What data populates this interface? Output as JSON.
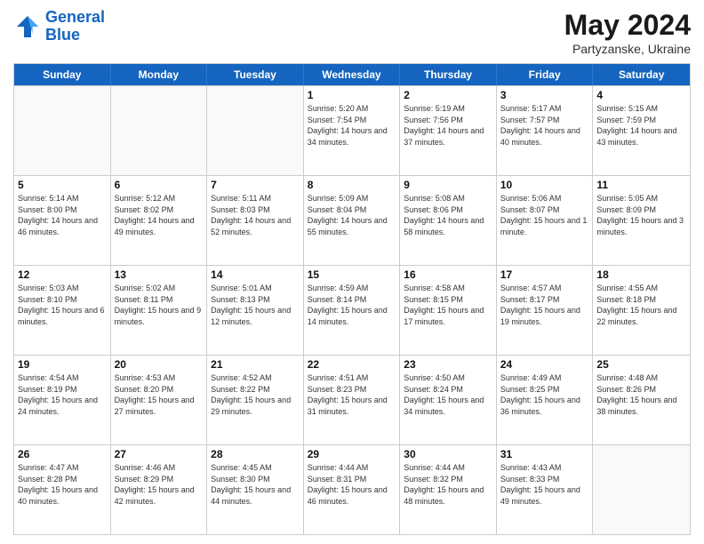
{
  "header": {
    "logo_line1": "General",
    "logo_line2": "Blue",
    "month_title": "May 2024",
    "location": "Partyzanske, Ukraine"
  },
  "days_of_week": [
    "Sunday",
    "Monday",
    "Tuesday",
    "Wednesday",
    "Thursday",
    "Friday",
    "Saturday"
  ],
  "weeks": [
    [
      {
        "day": "",
        "sunrise": "",
        "sunset": "",
        "daylight": "",
        "empty": true
      },
      {
        "day": "",
        "sunrise": "",
        "sunset": "",
        "daylight": "",
        "empty": true
      },
      {
        "day": "",
        "sunrise": "",
        "sunset": "",
        "daylight": "",
        "empty": true
      },
      {
        "day": "1",
        "sunrise": "Sunrise: 5:20 AM",
        "sunset": "Sunset: 7:54 PM",
        "daylight": "Daylight: 14 hours and 34 minutes.",
        "empty": false
      },
      {
        "day": "2",
        "sunrise": "Sunrise: 5:19 AM",
        "sunset": "Sunset: 7:56 PM",
        "daylight": "Daylight: 14 hours and 37 minutes.",
        "empty": false
      },
      {
        "day": "3",
        "sunrise": "Sunrise: 5:17 AM",
        "sunset": "Sunset: 7:57 PM",
        "daylight": "Daylight: 14 hours and 40 minutes.",
        "empty": false
      },
      {
        "day": "4",
        "sunrise": "Sunrise: 5:15 AM",
        "sunset": "Sunset: 7:59 PM",
        "daylight": "Daylight: 14 hours and 43 minutes.",
        "empty": false
      }
    ],
    [
      {
        "day": "5",
        "sunrise": "Sunrise: 5:14 AM",
        "sunset": "Sunset: 8:00 PM",
        "daylight": "Daylight: 14 hours and 46 minutes.",
        "empty": false
      },
      {
        "day": "6",
        "sunrise": "Sunrise: 5:12 AM",
        "sunset": "Sunset: 8:02 PM",
        "daylight": "Daylight: 14 hours and 49 minutes.",
        "empty": false
      },
      {
        "day": "7",
        "sunrise": "Sunrise: 5:11 AM",
        "sunset": "Sunset: 8:03 PM",
        "daylight": "Daylight: 14 hours and 52 minutes.",
        "empty": false
      },
      {
        "day": "8",
        "sunrise": "Sunrise: 5:09 AM",
        "sunset": "Sunset: 8:04 PM",
        "daylight": "Daylight: 14 hours and 55 minutes.",
        "empty": false
      },
      {
        "day": "9",
        "sunrise": "Sunrise: 5:08 AM",
        "sunset": "Sunset: 8:06 PM",
        "daylight": "Daylight: 14 hours and 58 minutes.",
        "empty": false
      },
      {
        "day": "10",
        "sunrise": "Sunrise: 5:06 AM",
        "sunset": "Sunset: 8:07 PM",
        "daylight": "Daylight: 15 hours and 1 minute.",
        "empty": false
      },
      {
        "day": "11",
        "sunrise": "Sunrise: 5:05 AM",
        "sunset": "Sunset: 8:09 PM",
        "daylight": "Daylight: 15 hours and 3 minutes.",
        "empty": false
      }
    ],
    [
      {
        "day": "12",
        "sunrise": "Sunrise: 5:03 AM",
        "sunset": "Sunset: 8:10 PM",
        "daylight": "Daylight: 15 hours and 6 minutes.",
        "empty": false
      },
      {
        "day": "13",
        "sunrise": "Sunrise: 5:02 AM",
        "sunset": "Sunset: 8:11 PM",
        "daylight": "Daylight: 15 hours and 9 minutes.",
        "empty": false
      },
      {
        "day": "14",
        "sunrise": "Sunrise: 5:01 AM",
        "sunset": "Sunset: 8:13 PM",
        "daylight": "Daylight: 15 hours and 12 minutes.",
        "empty": false
      },
      {
        "day": "15",
        "sunrise": "Sunrise: 4:59 AM",
        "sunset": "Sunset: 8:14 PM",
        "daylight": "Daylight: 15 hours and 14 minutes.",
        "empty": false
      },
      {
        "day": "16",
        "sunrise": "Sunrise: 4:58 AM",
        "sunset": "Sunset: 8:15 PM",
        "daylight": "Daylight: 15 hours and 17 minutes.",
        "empty": false
      },
      {
        "day": "17",
        "sunrise": "Sunrise: 4:57 AM",
        "sunset": "Sunset: 8:17 PM",
        "daylight": "Daylight: 15 hours and 19 minutes.",
        "empty": false
      },
      {
        "day": "18",
        "sunrise": "Sunrise: 4:55 AM",
        "sunset": "Sunset: 8:18 PM",
        "daylight": "Daylight: 15 hours and 22 minutes.",
        "empty": false
      }
    ],
    [
      {
        "day": "19",
        "sunrise": "Sunrise: 4:54 AM",
        "sunset": "Sunset: 8:19 PM",
        "daylight": "Daylight: 15 hours and 24 minutes.",
        "empty": false
      },
      {
        "day": "20",
        "sunrise": "Sunrise: 4:53 AM",
        "sunset": "Sunset: 8:20 PM",
        "daylight": "Daylight: 15 hours and 27 minutes.",
        "empty": false
      },
      {
        "day": "21",
        "sunrise": "Sunrise: 4:52 AM",
        "sunset": "Sunset: 8:22 PM",
        "daylight": "Daylight: 15 hours and 29 minutes.",
        "empty": false
      },
      {
        "day": "22",
        "sunrise": "Sunrise: 4:51 AM",
        "sunset": "Sunset: 8:23 PM",
        "daylight": "Daylight: 15 hours and 31 minutes.",
        "empty": false
      },
      {
        "day": "23",
        "sunrise": "Sunrise: 4:50 AM",
        "sunset": "Sunset: 8:24 PM",
        "daylight": "Daylight: 15 hours and 34 minutes.",
        "empty": false
      },
      {
        "day": "24",
        "sunrise": "Sunrise: 4:49 AM",
        "sunset": "Sunset: 8:25 PM",
        "daylight": "Daylight: 15 hours and 36 minutes.",
        "empty": false
      },
      {
        "day": "25",
        "sunrise": "Sunrise: 4:48 AM",
        "sunset": "Sunset: 8:26 PM",
        "daylight": "Daylight: 15 hours and 38 minutes.",
        "empty": false
      }
    ],
    [
      {
        "day": "26",
        "sunrise": "Sunrise: 4:47 AM",
        "sunset": "Sunset: 8:28 PM",
        "daylight": "Daylight: 15 hours and 40 minutes.",
        "empty": false
      },
      {
        "day": "27",
        "sunrise": "Sunrise: 4:46 AM",
        "sunset": "Sunset: 8:29 PM",
        "daylight": "Daylight: 15 hours and 42 minutes.",
        "empty": false
      },
      {
        "day": "28",
        "sunrise": "Sunrise: 4:45 AM",
        "sunset": "Sunset: 8:30 PM",
        "daylight": "Daylight: 15 hours and 44 minutes.",
        "empty": false
      },
      {
        "day": "29",
        "sunrise": "Sunrise: 4:44 AM",
        "sunset": "Sunset: 8:31 PM",
        "daylight": "Daylight: 15 hours and 46 minutes.",
        "empty": false
      },
      {
        "day": "30",
        "sunrise": "Sunrise: 4:44 AM",
        "sunset": "Sunset: 8:32 PM",
        "daylight": "Daylight: 15 hours and 48 minutes.",
        "empty": false
      },
      {
        "day": "31",
        "sunrise": "Sunrise: 4:43 AM",
        "sunset": "Sunset: 8:33 PM",
        "daylight": "Daylight: 15 hours and 49 minutes.",
        "empty": false
      },
      {
        "day": "",
        "sunrise": "",
        "sunset": "",
        "daylight": "",
        "empty": true
      }
    ]
  ]
}
